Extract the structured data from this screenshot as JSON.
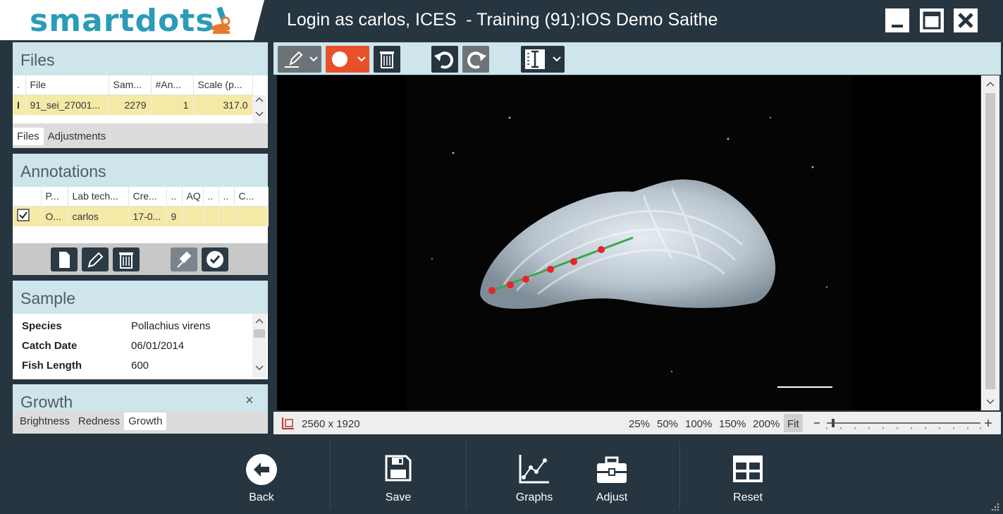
{
  "app": {
    "logo_smart": "smart",
    "logo_dots": "dots",
    "window_title": "Login as carlos, ICES  - Training (91):IOS Demo Saithe"
  },
  "files_panel": {
    "title": "Files",
    "columns": [
      ".",
      "File",
      "Sam...",
      "#An...",
      "Scale (p..."
    ],
    "rows": [
      {
        "marker": "I",
        "file": "91_sei_27001...",
        "sample": "2279",
        "annotations": "1",
        "scale": "317.0"
      }
    ],
    "tabs": [
      "Files",
      "Adjustments"
    ]
  },
  "annotations_panel": {
    "title": "Annotations",
    "columns": [
      "",
      "P...",
      "Lab tech...",
      "Cre...",
      "..",
      "AQ",
      "..",
      "..",
      "C..."
    ],
    "rows": [
      {
        "checked": true,
        "p": "O...",
        "lab_tech": "carlos",
        "created": "17-0...",
        "col5": "9",
        "aq": "",
        "c7": "",
        "c8": "",
        "c9": ""
      }
    ]
  },
  "sample_panel": {
    "title": "Sample",
    "fields": [
      {
        "label": "Species",
        "value": "Pollachius virens"
      },
      {
        "label": "Catch Date",
        "value": "06/01/2014"
      },
      {
        "label": "Fish Length",
        "value": "600"
      }
    ]
  },
  "growth_panel": {
    "title": "Growth",
    "close": "×",
    "tabs": [
      "Brightness",
      "Redness",
      "Growth"
    ],
    "active_tab": "Growth"
  },
  "viewer": {
    "image_size": "2560 x 1920",
    "zoom_options": [
      "25%",
      "50%",
      "100%",
      "150%",
      "200%",
      "Fit"
    ],
    "active_zoom": "Fit",
    "annotation_color": "#e8232a",
    "line_color": "#3aa84b"
  },
  "bottom_bar": {
    "back": "Back",
    "save": "Save",
    "graphs": "Graphs",
    "adjust": "Adjust",
    "reset": "Reset"
  }
}
